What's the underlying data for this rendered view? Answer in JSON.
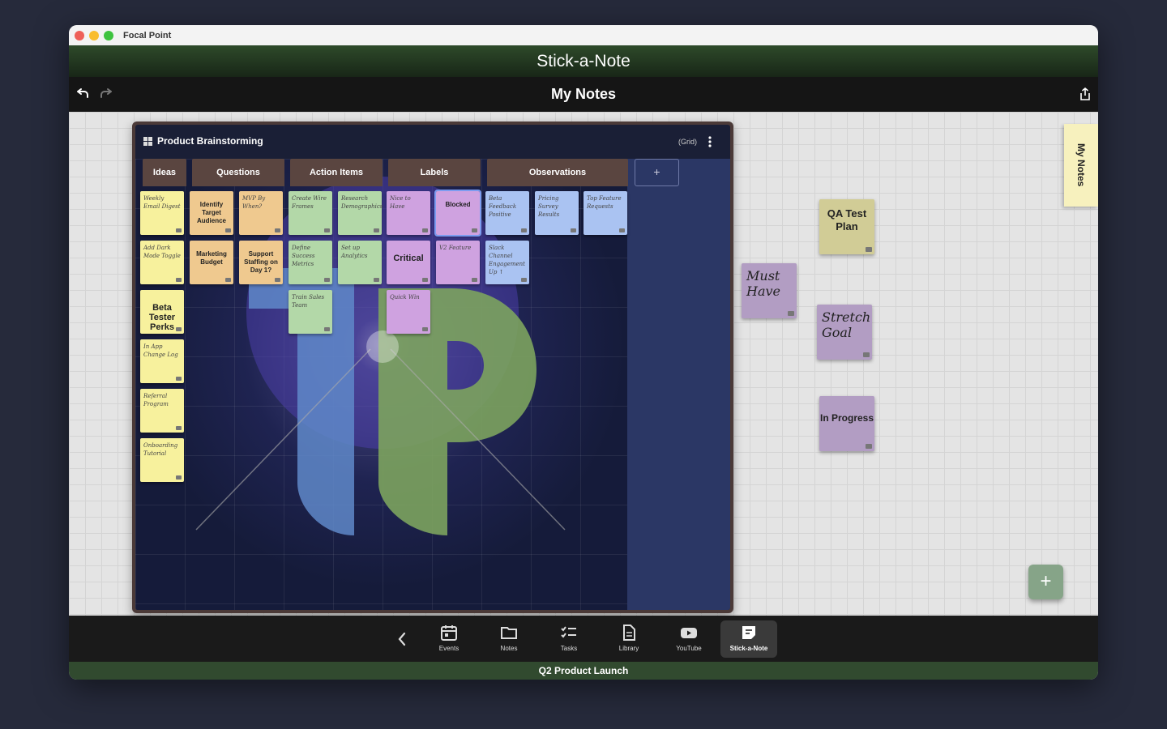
{
  "window": {
    "app_title": "Focal Point"
  },
  "header": {
    "module_title": "Stick-a-Note"
  },
  "toolbar": {
    "title": "My Notes"
  },
  "board": {
    "title": "Product Brainstorming",
    "view_label": "(Grid)",
    "add_column": "+",
    "columns": [
      "Ideas",
      "Questions",
      "Action Items",
      "Labels",
      "Observations"
    ],
    "notes": {
      "ideas_1": "Weekly Email Digest",
      "ideas_2": "Add Dark Mode Toggle",
      "ideas_3": "Beta Tester Perks",
      "ideas_4": "In App Change Log",
      "ideas_5": "Referral Program",
      "ideas_6": "Onboarding Tutorial",
      "q_1": "Identify Target Audience",
      "q_2": "MVP By When?",
      "q_3": "Marketing Budget",
      "q_4": "Support Staffing on Day 1?",
      "a_1": "Create Wire Frames",
      "a_2": "Research Demographics",
      "a_3": "Define Success Metrics",
      "a_4": "Set up Analytics",
      "a_5": "Train Sales Team",
      "l_1": "Nice to Have",
      "l_2": "Blocked",
      "l_3": "Critical",
      "l_4": "V2 Feature",
      "l_5": "Quick Win",
      "o_1": "Beta Feedback Positive",
      "o_2": "Pricing Survey Results",
      "o_3": "Top Feature Requests",
      "o_4": "Slack Channel Engagement Up ↑"
    }
  },
  "side_notes": {
    "must_have": "Must Have",
    "qa_test_plan": "QA Test Plan",
    "stretch_goal": "Stretch Goal",
    "in_progress": "In Progress"
  },
  "side_tab": "My Notes",
  "fab": "+",
  "tabbar": {
    "items": [
      {
        "label": "Events",
        "icon": "calendar-icon"
      },
      {
        "label": "Notes",
        "icon": "folder-icon"
      },
      {
        "label": "Tasks",
        "icon": "checklist-icon"
      },
      {
        "label": "Library",
        "icon": "document-icon"
      },
      {
        "label": "YouTube",
        "icon": "youtube-icon"
      },
      {
        "label": "Stick-a-Note",
        "icon": "sticky-note-icon"
      }
    ]
  },
  "footer": {
    "project": "Q2 Product Launch"
  },
  "colors": {
    "yellow": "#f7f19d",
    "orange": "#efc98f",
    "green": "#b3d8a8",
    "purple": "#cfa2e0",
    "blue": "#aac3f2",
    "accent_green": "#2e4a2a"
  }
}
